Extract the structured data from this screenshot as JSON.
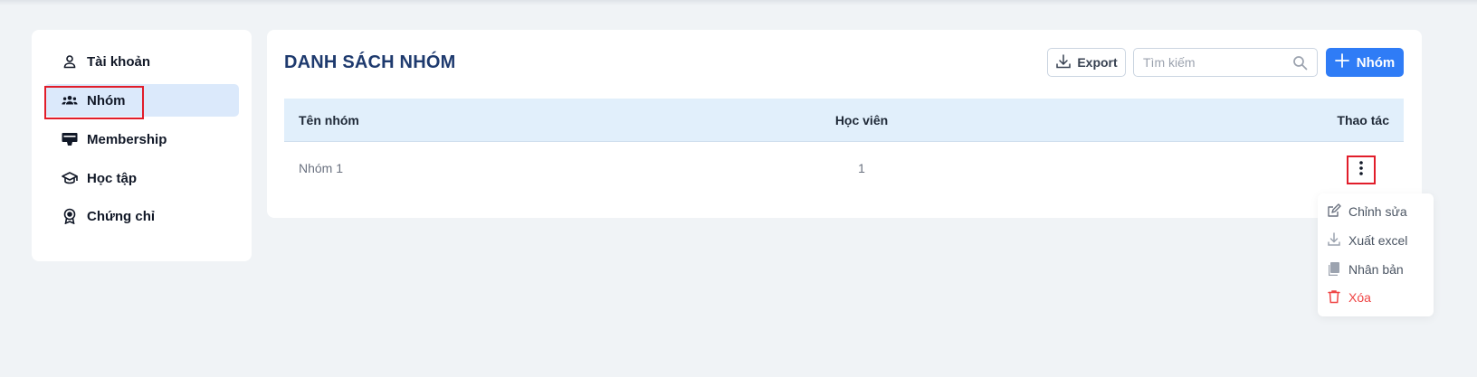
{
  "sidebar": {
    "items": [
      {
        "label": "Tài khoản",
        "icon": "user-icon",
        "active": false
      },
      {
        "label": "Nhóm",
        "icon": "users-group-icon",
        "active": true
      },
      {
        "label": "Membership",
        "icon": "membership-card-icon",
        "active": false
      },
      {
        "label": "Học tập",
        "icon": "graduation-cap-icon",
        "active": false
      },
      {
        "label": "Chứng chỉ",
        "icon": "certificate-badge-icon",
        "active": false
      }
    ]
  },
  "main": {
    "title": "DANH SÁCH NHÓM",
    "export_label": "Export",
    "search_placeholder": "Tìm kiếm",
    "add_label": "Nhóm",
    "table": {
      "columns": [
        "Tên nhóm",
        "Học viên",
        "Thao tác"
      ],
      "rows": [
        {
          "name": "Nhóm 1",
          "count": "1"
        }
      ]
    },
    "actions_menu": [
      {
        "label": "Chỉnh sửa",
        "icon": "edit-icon"
      },
      {
        "label": "Xuất excel",
        "icon": "download-icon"
      },
      {
        "label": "Nhân bản",
        "icon": "duplicate-icon"
      },
      {
        "label": "Xóa",
        "icon": "trash-icon"
      }
    ]
  },
  "colors": {
    "primary": "#2f7cf6",
    "title": "#1e3a6e",
    "danger": "#ef4444",
    "active_bg": "#dbe9fb",
    "table_header_bg": "#e1effb",
    "highlight_box": "#e11d2a"
  }
}
